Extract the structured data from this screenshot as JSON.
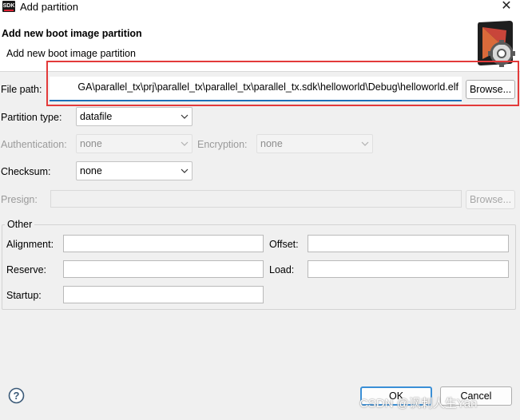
{
  "window": {
    "title": "Add partition",
    "logo_text": "SDK",
    "close_glyph": "✕"
  },
  "header": {
    "title": "Add new boot image partition",
    "description": "Add new boot image partition",
    "icon": "sdk-gear-icon"
  },
  "form": {
    "file_path": {
      "label": "File path:",
      "value": "GA\\parallel_tx\\prj\\parallel_tx\\parallel_tx\\parallel_tx.sdk\\helloworld\\Debug\\helloworld.elf",
      "browse_label": "Browse..."
    },
    "partition_type": {
      "label": "Partition type:",
      "value": "datafile"
    },
    "authentication": {
      "label": "Authentication:",
      "value": "none"
    },
    "encryption": {
      "label": "Encryption:",
      "value": "none"
    },
    "checksum": {
      "label": "Checksum:",
      "value": "none"
    },
    "presign": {
      "label": "Presign:",
      "value": "",
      "browse_label": "Browse..."
    }
  },
  "other": {
    "label": "Other",
    "alignment": {
      "label": "Alignment:",
      "value": ""
    },
    "offset": {
      "label": "Offset:",
      "value": ""
    },
    "reserve": {
      "label": "Reserve:",
      "value": ""
    },
    "load": {
      "label": "Load:",
      "value": ""
    },
    "startup": {
      "label": "Startup:",
      "value": ""
    }
  },
  "footer": {
    "help_glyph": "?",
    "ok_label": "OK",
    "cancel_label": "Cancel"
  },
  "watermark": "CSDN @讽刺人生Yan",
  "colors": {
    "accent": "#1c6fb8",
    "highlight_box": "#e33a3a",
    "default_button_border": "#3a8fd6"
  }
}
